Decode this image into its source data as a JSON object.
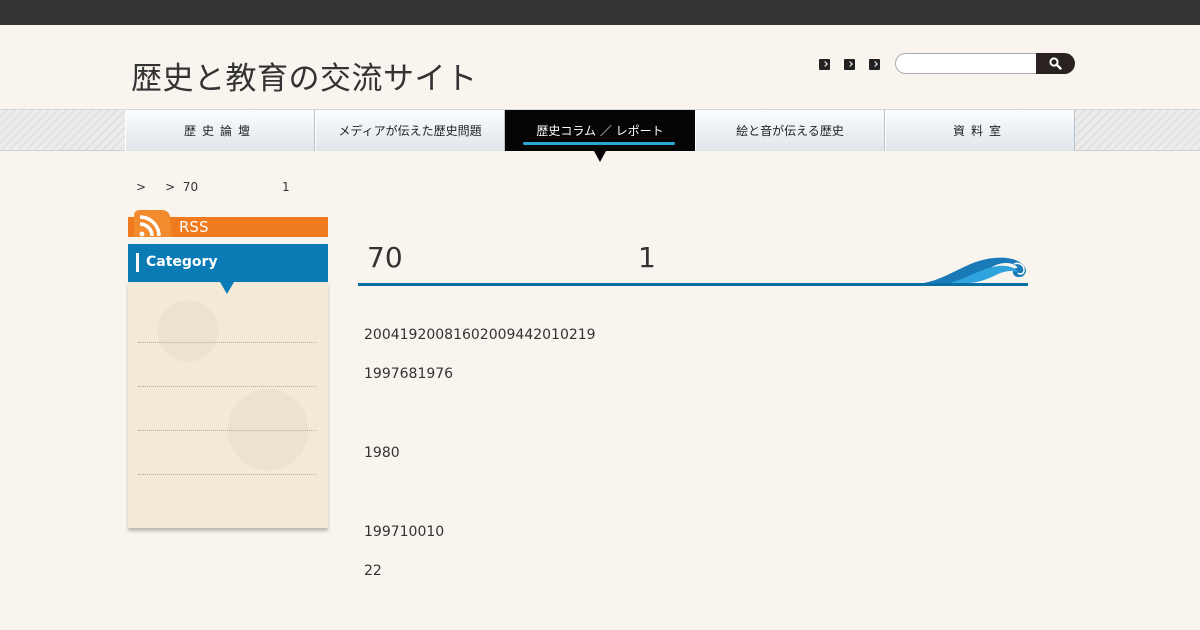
{
  "site": {
    "title": "歴史と教育の交流サイト"
  },
  "header_icons": [
    "arrow-icon-1",
    "arrow-icon-2",
    "arrow-icon-3"
  ],
  "search": {
    "placeholder": ""
  },
  "nav": [
    {
      "label": "歴史論壇",
      "active": false
    },
    {
      "label": "メディアが伝えた歴史問題",
      "active": false
    },
    {
      "label": "歴史コラム ／ レポート",
      "active": true
    },
    {
      "label": "絵と音が伝える歴史",
      "active": false
    },
    {
      "label": "資料室",
      "active": false
    }
  ],
  "breadcrumb": ">     >  70                      1",
  "sidebar": {
    "rss_label": "RSS",
    "category_label": "Category",
    "colors": {
      "rss": "#f07b1e",
      "category": "#0a7bb5"
    }
  },
  "article": {
    "title_left": "70",
    "title_right": "1",
    "paragraphs": [
      "20041920081602009442010219",
      "1997681976",
      "1980",
      "199710010",
      "22"
    ]
  },
  "colors": {
    "accent": "#29a7d8",
    "title_rule": "#0a6fa4",
    "background": "#f9f4ee"
  }
}
